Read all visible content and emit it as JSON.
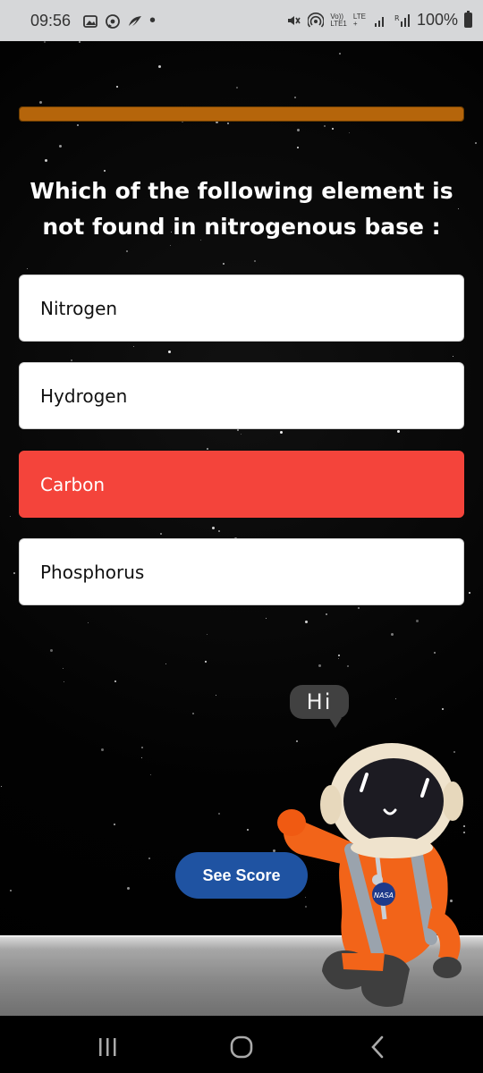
{
  "status": {
    "time": "09:56",
    "dot": "•",
    "network_volte": "Vo))",
    "network_lte": "LTE",
    "network_lte1": "LTE1",
    "network_plus": "+",
    "battery": "100%"
  },
  "quiz": {
    "progress": 1.0,
    "question": "Which of the following element is not found in nitrogenous base :",
    "options": [
      "Nitrogen",
      "Hydrogen",
      "Carbon",
      "Phosphorus"
    ],
    "selected_index": 2,
    "see_score": "See Score",
    "mascot_speech": "Hi",
    "mascot_badge": "NASA"
  },
  "colors": {
    "progress": "#b5650b",
    "selected": "#f4443b",
    "button": "#1f53a2"
  }
}
